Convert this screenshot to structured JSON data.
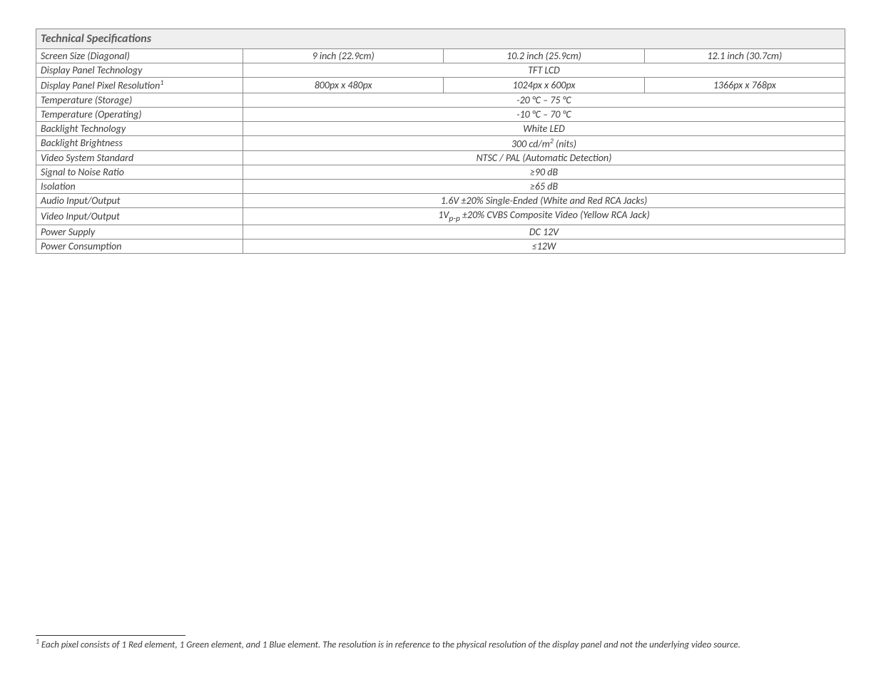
{
  "header": "Technical Specifications",
  "rows": {
    "screen_size": {
      "label": "Screen Size (Diagonal)",
      "c1": "9 inch (22.9cm)",
      "c2": "10.2 inch (25.9cm)",
      "c3": "12.1 inch (30.7cm)"
    },
    "panel_tech": {
      "label": "Display Panel Technology",
      "value": "TFT LCD"
    },
    "pixel_res": {
      "label_prefix": "Display Panel Pixel Resolution",
      "sup": "1",
      "c1": "800px x 480px",
      "c2": "1024px x 600px",
      "c3": "1366px x 768px"
    },
    "temp_storage": {
      "label": "Temperature (Storage)",
      "value": "-20 °C – 75 °C"
    },
    "temp_operating": {
      "label": "Temperature (Operating)",
      "value": "-10 °C – 70 °C"
    },
    "backlight_tech": {
      "label": "Backlight Technology",
      "value": "White LED"
    },
    "backlight_bright": {
      "label": "Backlight Brightness",
      "value_prefix": "300 cd/m",
      "value_sup": "2",
      "value_suffix": " (nits)"
    },
    "video_std": {
      "label": "Video System Standard",
      "value": "NTSC / PAL (Automatic Detection)"
    },
    "snr": {
      "label": "Signal to Noise Ratio",
      "value": "≥90 dB"
    },
    "isolation": {
      "label": "Isolation",
      "value": "≥65 dB"
    },
    "audio_io": {
      "label": "Audio Input/Output",
      "value": "1.6V ±20% Single-Ended (White and Red RCA Jacks)"
    },
    "video_io": {
      "label": "Video Input/Output",
      "value_prefix": "1V",
      "value_sub": "p-p",
      "value_suffix": " ±20% CVBS Composite Video (Yellow RCA Jack)"
    },
    "power_supply": {
      "label": "Power Supply",
      "value": "DC 12V"
    },
    "power_consumption": {
      "label": "Power Consumption",
      "value": "≤12W"
    }
  },
  "footnote": {
    "marker": "1",
    "text": " Each pixel consists of 1 Red element, 1 Green element, and 1 Blue element. The resolution is in reference to the physical resolution of the display panel and not the underlying video source."
  }
}
